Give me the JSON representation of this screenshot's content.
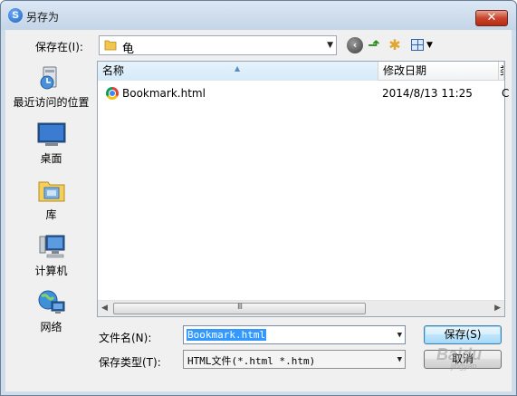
{
  "window": {
    "title": "另存为",
    "close_label": "✕"
  },
  "toolbar": {
    "save_in_label": "保存在(I):",
    "current_folder": "龟",
    "icons": [
      "back-icon",
      "up-folder-icon",
      "new-folder-icon",
      "view-menu-icon"
    ]
  },
  "places": [
    {
      "label": "最近访问的位置",
      "icon": "recent-places-icon"
    },
    {
      "label": "桌面",
      "icon": "desktop-icon"
    },
    {
      "label": "库",
      "icon": "libraries-icon"
    },
    {
      "label": "计算机",
      "icon": "computer-icon"
    },
    {
      "label": "网络",
      "icon": "network-icon"
    }
  ],
  "file_list": {
    "columns": [
      "名称",
      "修改日期",
      "类"
    ],
    "rows": [
      {
        "name": "Bookmark.html",
        "modified": "2014/8/13 11:25",
        "extra": "C",
        "icon": "chrome-icon"
      }
    ],
    "scroll_grip": "III"
  },
  "form": {
    "filename_label": "文件名(N):",
    "filename_value": "Bookmark.html",
    "filetype_label": "保存类型(T):",
    "filetype_value": "HTML文件(*.html *.htm)",
    "save_button": "保存(S)",
    "cancel_button": "取消"
  },
  "watermark": {
    "brand": "Baidu",
    "sub": "jingyan"
  }
}
